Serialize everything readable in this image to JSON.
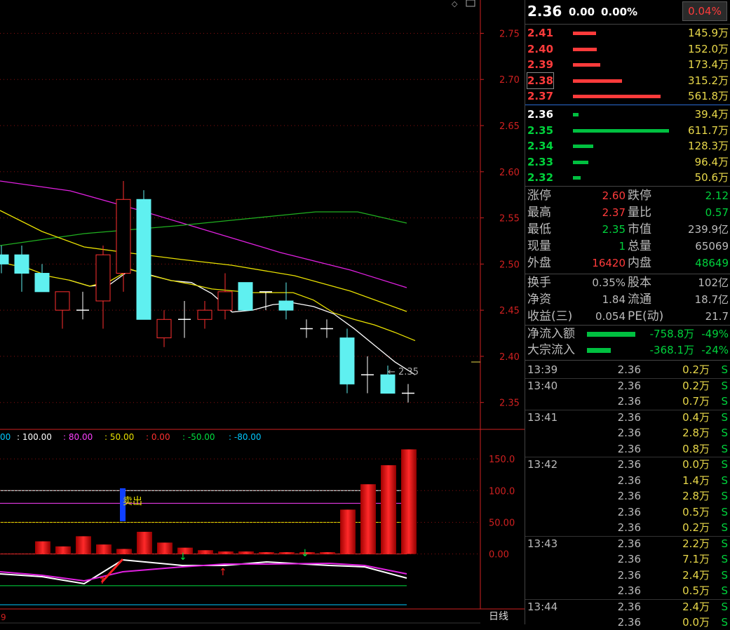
{
  "header": {
    "price": "2.36",
    "change": "0.00",
    "change_pct": "0.00%",
    "badge": "0.04%"
  },
  "asks": [
    {
      "price": "2.41",
      "volume": "145.9万",
      "ratio": 0.26
    },
    {
      "price": "2.40",
      "volume": "152.0万",
      "ratio": 0.27
    },
    {
      "price": "2.39",
      "volume": "173.4万",
      "ratio": 0.31
    },
    {
      "price": "2.38",
      "volume": "315.2万",
      "ratio": 0.56
    },
    {
      "price": "2.37",
      "volume": "561.8万",
      "ratio": 1.0
    }
  ],
  "bids": [
    {
      "price": "2.36",
      "volume": "39.4万",
      "ratio": 0.06
    },
    {
      "price": "2.35",
      "volume": "611.7万",
      "ratio": 1.0
    },
    {
      "price": "2.34",
      "volume": "128.3万",
      "ratio": 0.21
    },
    {
      "price": "2.33",
      "volume": "96.4万",
      "ratio": 0.16
    },
    {
      "price": "2.32",
      "volume": "50.6万",
      "ratio": 0.08
    }
  ],
  "stats": [
    {
      "l1": "涨停",
      "v1": "2.60",
      "c1": "red",
      "l2": "跌停",
      "v2": "2.12",
      "c2": "green"
    },
    {
      "l1": "最高",
      "v1": "2.37",
      "c1": "red",
      "l2": "量比",
      "v2": "0.57",
      "c2": "green"
    },
    {
      "l1": "最低",
      "v1": "2.35",
      "c1": "green",
      "l2": "市值",
      "v2": "239.9亿",
      "c2": "grey"
    },
    {
      "l1": "现量",
      "v1": "1",
      "c1": "green",
      "l2": "总量",
      "v2": "65069",
      "c2": "grey"
    },
    {
      "l1": "外盘",
      "v1": "16420",
      "c1": "red",
      "l2": "内盘",
      "v2": "48649",
      "c2": "green"
    }
  ],
  "stats2": [
    {
      "l1": "换手",
      "v1": "0.35%",
      "l2": "股本",
      "v2": "102亿"
    },
    {
      "l1": "净资",
      "v1": "1.84",
      "l2": "流通",
      "v2": "18.7亿"
    },
    {
      "l1": "收益(三)",
      "v1": "0.054",
      "l2": "PE(动)",
      "v2": "21.7"
    }
  ],
  "flows": [
    {
      "label": "净流入额",
      "value": "-758.8万",
      "pct": "-49%",
      "ratio": 0.49
    },
    {
      "label": "大宗流入",
      "value": "-368.1万",
      "pct": "-24%",
      "ratio": 0.24
    }
  ],
  "ticks": [
    {
      "time": "13:39",
      "price": "2.36",
      "vol": "0.2万",
      "side": "S"
    },
    {
      "time": "13:40",
      "price": "2.36",
      "vol": "0.2万",
      "side": "S"
    },
    {
      "time": "",
      "price": "2.36",
      "vol": "0.7万",
      "side": "S"
    },
    {
      "time": "13:41",
      "price": "2.36",
      "vol": "0.4万",
      "side": "S"
    },
    {
      "time": "",
      "price": "2.36",
      "vol": "2.8万",
      "side": "S"
    },
    {
      "time": "",
      "price": "2.36",
      "vol": "0.8万",
      "side": "S"
    },
    {
      "time": "13:42",
      "price": "2.36",
      "vol": "0.0万",
      "side": "S"
    },
    {
      "time": "",
      "price": "2.36",
      "vol": "1.4万",
      "side": "S"
    },
    {
      "time": "",
      "price": "2.36",
      "vol": "2.8万",
      "side": "S"
    },
    {
      "time": "",
      "price": "2.36",
      "vol": "0.5万",
      "side": "S"
    },
    {
      "time": "",
      "price": "2.36",
      "vol": "0.2万",
      "side": "S"
    },
    {
      "time": "13:43",
      "price": "2.36",
      "vol": "2.2万",
      "side": "S"
    },
    {
      "time": "",
      "price": "2.36",
      "vol": "7.1万",
      "side": "S"
    },
    {
      "time": "",
      "price": "2.36",
      "vol": "2.4万",
      "side": "S"
    },
    {
      "time": "",
      "price": "2.36",
      "vol": "0.5万",
      "side": "S"
    },
    {
      "time": "13:44",
      "price": "2.36",
      "vol": "2.4万",
      "side": "S"
    },
    {
      "time": "",
      "price": "2.36",
      "vol": "0.0万",
      "side": "S"
    }
  ],
  "chart_data": [
    {
      "type": "candlestick",
      "yticks": [
        "2.75",
        "2.70",
        "2.65",
        "2.60",
        "2.55",
        "2.50",
        "2.45",
        "2.40",
        "2.35"
      ],
      "ylim": [
        2.33,
        2.78
      ],
      "last_label": "2.35",
      "candles": [
        {
          "o": 2.51,
          "c": 2.5,
          "h": 2.52,
          "l": 2.49
        },
        {
          "o": 2.51,
          "c": 2.49,
          "h": 2.52,
          "l": 2.47
        },
        {
          "o": 2.49,
          "c": 2.47,
          "h": 2.5,
          "l": 2.47
        },
        {
          "o": 2.45,
          "c": 2.47,
          "h": 2.47,
          "l": 2.43
        },
        {
          "o": 2.45,
          "c": 2.45,
          "h": 2.47,
          "l": 2.44
        },
        {
          "o": 2.46,
          "c": 2.51,
          "h": 2.52,
          "l": 2.43
        },
        {
          "o": 2.49,
          "c": 2.57,
          "h": 2.59,
          "l": 2.47
        },
        {
          "o": 2.57,
          "c": 2.44,
          "h": 2.58,
          "l": 2.44
        },
        {
          "o": 2.42,
          "c": 2.44,
          "h": 2.45,
          "l": 2.41
        },
        {
          "o": 2.44,
          "c": 2.44,
          "h": 2.46,
          "l": 2.42
        },
        {
          "o": 2.44,
          "c": 2.45,
          "h": 2.46,
          "l": 2.43
        },
        {
          "o": 2.45,
          "c": 2.47,
          "h": 2.49,
          "l": 2.44
        },
        {
          "o": 2.48,
          "c": 2.45,
          "h": 2.48,
          "l": 2.45
        },
        {
          "o": 2.47,
          "c": 2.47,
          "h": 2.47,
          "l": 2.45
        },
        {
          "o": 2.46,
          "c": 2.45,
          "h": 2.48,
          "l": 2.44
        },
        {
          "o": 2.43,
          "c": 2.43,
          "h": 2.44,
          "l": 2.42
        },
        {
          "o": 2.43,
          "c": 2.43,
          "h": 2.44,
          "l": 2.42
        },
        {
          "o": 2.42,
          "c": 2.37,
          "h": 2.43,
          "l": 2.36
        },
        {
          "o": 2.38,
          "c": 2.38,
          "h": 2.4,
          "l": 2.36
        },
        {
          "o": 2.38,
          "c": 2.36,
          "h": 2.39,
          "l": 2.36
        },
        {
          "o": 2.36,
          "c": 2.36,
          "h": 2.37,
          "l": 2.35
        }
      ]
    },
    {
      "type": "bar",
      "legend": [
        {
          "text": "00",
          "color": "#00c8ff"
        },
        {
          "text": ": 100.00",
          "color": "#ffffff"
        },
        {
          "text": ": 80.00",
          "color": "#ff40ff"
        },
        {
          "text": ": 50.00",
          "color": "#e8e000"
        },
        {
          "text": ": 0.00",
          "color": "#ff3030"
        },
        {
          "text": ": -50.00",
          "color": "#00e040"
        },
        {
          "text": ": -80.00",
          "color": "#00c8ff"
        }
      ],
      "yticks": [
        "150.0",
        "100.0",
        "50.00",
        "0.00"
      ],
      "ylim": [
        -80,
        170
      ],
      "values": [
        0,
        0,
        20,
        12,
        28,
        15,
        8,
        35,
        18,
        10,
        6,
        4,
        4,
        3,
        3,
        3,
        3,
        70,
        110,
        140,
        165
      ],
      "signal": "卖出",
      "period_label": "日线"
    }
  ]
}
